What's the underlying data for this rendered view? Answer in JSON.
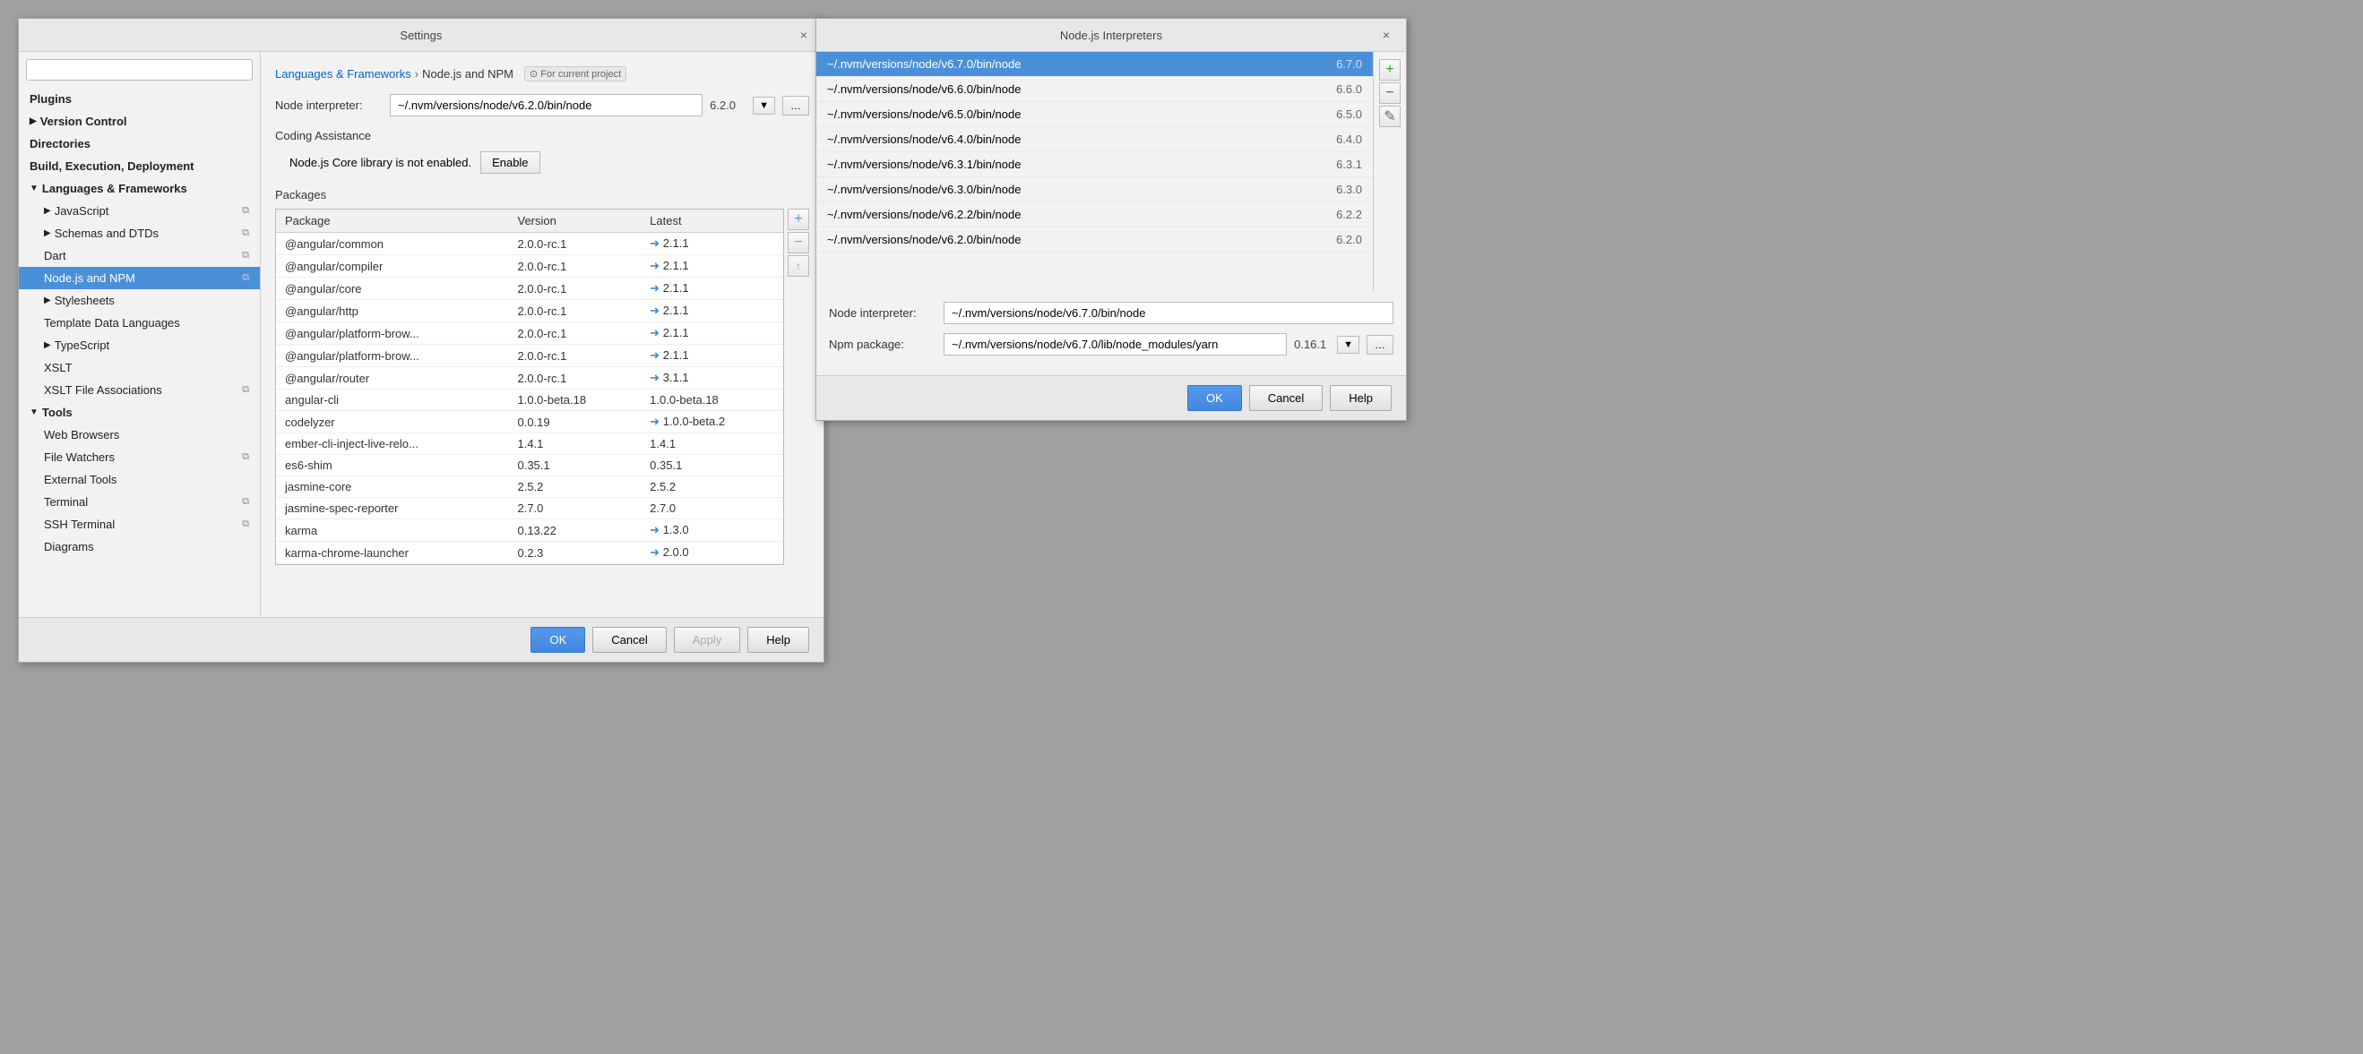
{
  "settings": {
    "title": "Settings",
    "close": "×",
    "breadcrumb": {
      "parent": "Languages & Frameworks",
      "separator": "›",
      "current": "Node.js and NPM",
      "badge": "⊙ For current project"
    },
    "search_placeholder": "",
    "sidebar": {
      "items": [
        {
          "id": "plugins",
          "label": "Plugins",
          "level": 0,
          "bold": true,
          "has_arrow": false
        },
        {
          "id": "version-control",
          "label": "Version Control",
          "level": 0,
          "bold": true,
          "has_arrow": true,
          "arrow": "▶"
        },
        {
          "id": "directories",
          "label": "Directories",
          "level": 0,
          "bold": true,
          "has_arrow": false
        },
        {
          "id": "build-execution",
          "label": "Build, Execution, Deployment",
          "level": 0,
          "bold": true,
          "has_arrow": false
        },
        {
          "id": "languages-frameworks",
          "label": "Languages & Frameworks",
          "level": 0,
          "bold": true,
          "has_arrow": true,
          "arrow": "▼"
        },
        {
          "id": "javascript",
          "label": "JavaScript",
          "level": 1,
          "has_arrow": true,
          "arrow": "▶",
          "has_icon": true
        },
        {
          "id": "schemas-dtds",
          "label": "Schemas and DTDs",
          "level": 1,
          "has_arrow": true,
          "arrow": "▶",
          "has_icon": true
        },
        {
          "id": "dart",
          "label": "Dart",
          "level": 1,
          "has_arrow": false,
          "has_icon": true
        },
        {
          "id": "nodejs-npm",
          "label": "Node.js and NPM",
          "level": 1,
          "selected": true,
          "has_icon": true
        },
        {
          "id": "stylesheets",
          "label": "Stylesheets",
          "level": 1,
          "has_arrow": true,
          "arrow": "▶",
          "has_icon": false
        },
        {
          "id": "template-data",
          "label": "Template Data Languages",
          "level": 1,
          "has_arrow": false,
          "has_icon": false
        },
        {
          "id": "typescript",
          "label": "TypeScript",
          "level": 1,
          "has_arrow": true,
          "arrow": "▶",
          "has_icon": false
        },
        {
          "id": "xslt",
          "label": "XSLT",
          "level": 1,
          "has_arrow": false,
          "has_icon": false
        },
        {
          "id": "xslt-file",
          "label": "XSLT File Associations",
          "level": 1,
          "has_arrow": false,
          "has_icon": true
        },
        {
          "id": "tools",
          "label": "Tools",
          "level": 0,
          "bold": true,
          "has_arrow": true,
          "arrow": "▼"
        },
        {
          "id": "web-browsers",
          "label": "Web Browsers",
          "level": 1,
          "has_arrow": false
        },
        {
          "id": "file-watchers",
          "label": "File Watchers",
          "level": 1,
          "has_arrow": false,
          "has_icon": true
        },
        {
          "id": "external-tools",
          "label": "External Tools",
          "level": 1,
          "has_arrow": false
        },
        {
          "id": "terminal",
          "label": "Terminal",
          "level": 1,
          "has_arrow": false,
          "has_icon": true
        },
        {
          "id": "ssh-terminal",
          "label": "SSH Terminal",
          "level": 1,
          "has_arrow": false,
          "has_icon": true
        },
        {
          "id": "diagrams",
          "label": "Diagrams",
          "level": 1,
          "has_arrow": false
        }
      ]
    },
    "main": {
      "node_interpreter_label": "Node interpreter:",
      "node_interpreter_value": "~/.nvm/versions/node/v6.2.0/bin/node",
      "node_interpreter_version": "6.2.0",
      "coding_assistance_label": "Coding Assistance",
      "core_library_msg": "Node.js Core library is not enabled.",
      "enable_btn": "Enable",
      "packages_label": "Packages",
      "table": {
        "headers": [
          "Package",
          "Version",
          "Latest"
        ],
        "rows": [
          {
            "package": "@angular/common",
            "version": "2.0.0-rc.1",
            "latest": "2.1.1",
            "has_arrow": true
          },
          {
            "package": "@angular/compiler",
            "version": "2.0.0-rc.1",
            "latest": "2.1.1",
            "has_arrow": true
          },
          {
            "package": "@angular/core",
            "version": "2.0.0-rc.1",
            "latest": "2.1.1",
            "has_arrow": true
          },
          {
            "package": "@angular/http",
            "version": "2.0.0-rc.1",
            "latest": "2.1.1",
            "has_arrow": true
          },
          {
            "package": "@angular/platform-brow...",
            "version": "2.0.0-rc.1",
            "latest": "2.1.1",
            "has_arrow": true
          },
          {
            "package": "@angular/platform-brow...",
            "version": "2.0.0-rc.1",
            "latest": "2.1.1",
            "has_arrow": true
          },
          {
            "package": "@angular/router",
            "version": "2.0.0-rc.1",
            "latest": "3.1.1",
            "has_arrow": true
          },
          {
            "package": "angular-cli",
            "version": "1.0.0-beta.18",
            "latest": "1.0.0-beta.18",
            "has_arrow": false
          },
          {
            "package": "codelyzer",
            "version": "0.0.19",
            "latest": "1.0.0-beta.2",
            "has_arrow": true
          },
          {
            "package": "ember-cli-inject-live-relo...",
            "version": "1.4.1",
            "latest": "1.4.1",
            "has_arrow": false
          },
          {
            "package": "es6-shim",
            "version": "0.35.1",
            "latest": "0.35.1",
            "has_arrow": false
          },
          {
            "package": "jasmine-core",
            "version": "2.5.2",
            "latest": "2.5.2",
            "has_arrow": false
          },
          {
            "package": "jasmine-spec-reporter",
            "version": "2.7.0",
            "latest": "2.7.0",
            "has_arrow": false
          },
          {
            "package": "karma",
            "version": "0.13.22",
            "latest": "1.3.0",
            "has_arrow": true
          },
          {
            "package": "karma-chrome-launcher",
            "version": "0.2.3",
            "latest": "2.0.0",
            "has_arrow": true
          }
        ]
      }
    },
    "footer": {
      "ok": "OK",
      "cancel": "Cancel",
      "apply": "Apply",
      "help": "Help"
    }
  },
  "interpreters": {
    "title": "Node.js Interpreters",
    "close": "×",
    "list": [
      {
        "path": "~/.nvm/versions/node/v6.7.0/bin/node",
        "version": "6.7.0",
        "selected": true
      },
      {
        "path": "~/.nvm/versions/node/v6.6.0/bin/node",
        "version": "6.6.0",
        "selected": false
      },
      {
        "path": "~/.nvm/versions/node/v6.5.0/bin/node",
        "version": "6.5.0",
        "selected": false
      },
      {
        "path": "~/.nvm/versions/node/v6.4.0/bin/node",
        "version": "6.4.0",
        "selected": false
      },
      {
        "path": "~/.nvm/versions/node/v6.3.1/bin/node",
        "version": "6.3.1",
        "selected": false
      },
      {
        "path": "~/.nvm/versions/node/v6.3.0/bin/node",
        "version": "6.3.0",
        "selected": false
      },
      {
        "path": "~/.nvm/versions/node/v6.2.2/bin/node",
        "version": "6.2.2",
        "selected": false
      },
      {
        "path": "~/.nvm/versions/node/v6.2.0/bin/node",
        "version": "6.2.0",
        "selected": false,
        "partial": true
      }
    ],
    "node_interpreter_label": "Node interpreter:",
    "node_interpreter_value": "~/.nvm/versions/node/v6.7.0/bin/node",
    "npm_package_label": "Npm package:",
    "npm_package_value": "~/.nvm/versions/node/v6.7.0/lib/node_modules/yarn",
    "npm_package_version": "0.16.1",
    "actions": {
      "add": "+",
      "remove": "−",
      "edit": "✎"
    },
    "footer": {
      "ok": "OK",
      "cancel": "Cancel",
      "help": "Help"
    }
  }
}
